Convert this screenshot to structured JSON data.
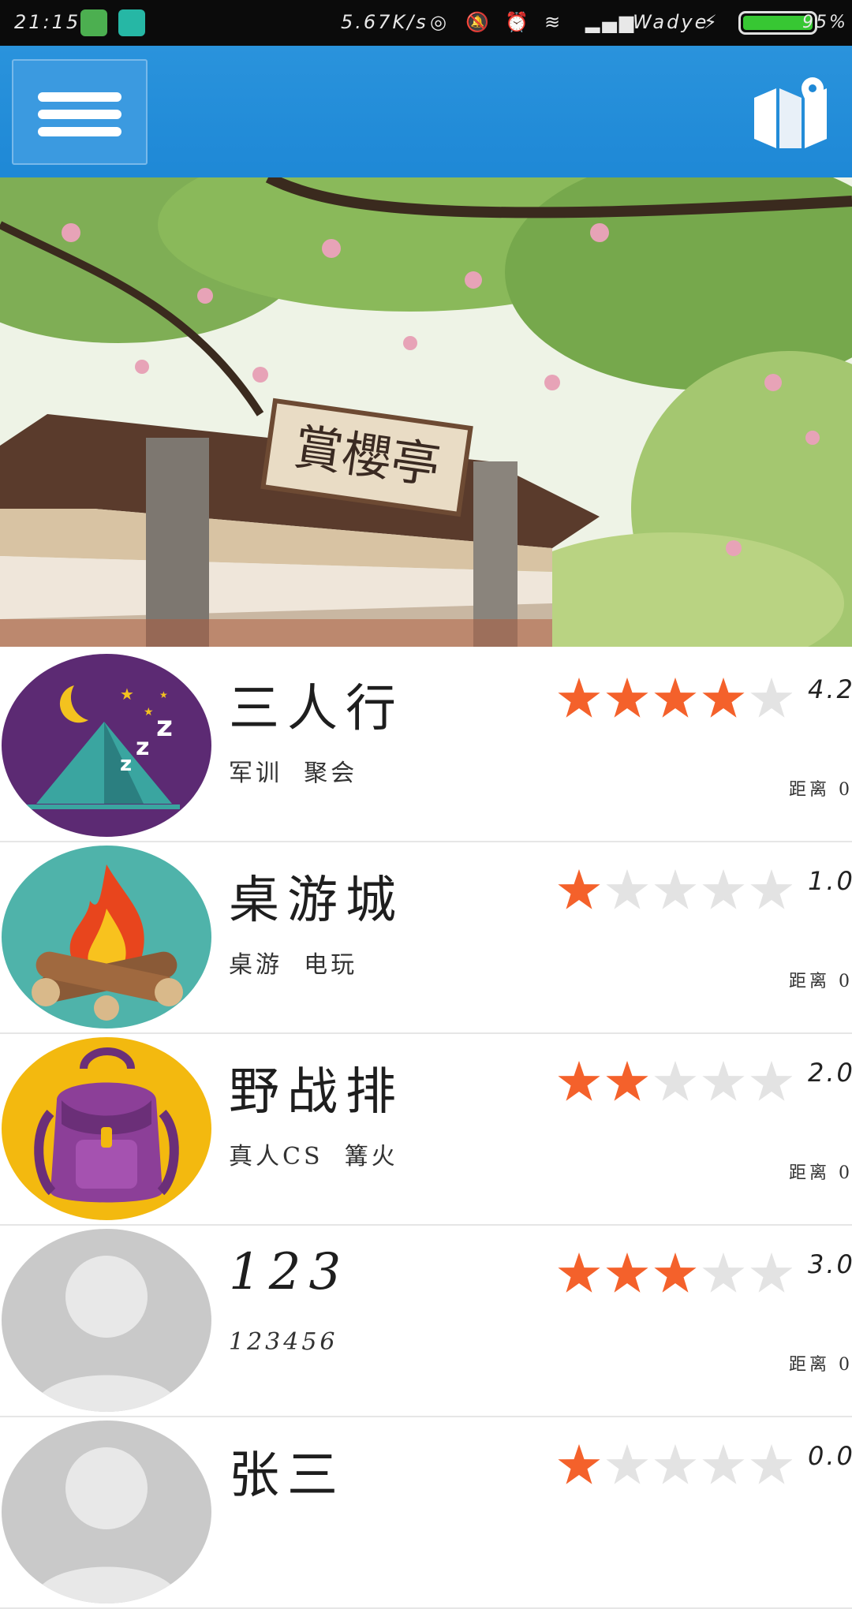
{
  "status_bar": {
    "time": "21:15",
    "net_speed": "5.67K/s",
    "carrier": "Wadye",
    "battery": "95%",
    "battery_level": 0.95
  },
  "header": {
    "menu_icon": "hamburger-menu-icon",
    "map_icon": "map-pin-icon"
  },
  "banner": {
    "sign_text": "賞櫻亭"
  },
  "list": {
    "items": [
      {
        "name": "三人行",
        "tags": "军训  聚会",
        "score": "4.2",
        "rating": 4.2,
        "distance_label": "距离 0",
        "avatar": "tent-night-icon",
        "avatar_bg": "#5c2a73"
      },
      {
        "name": "桌游城",
        "tags": "桌游  电玩",
        "score": "1.0",
        "rating": 1.0,
        "distance_label": "距离 0",
        "avatar": "campfire-icon",
        "avatar_bg": "#4fb3aa"
      },
      {
        "name": "野战排",
        "tags": "真人CS  篝火",
        "score": "2.0",
        "rating": 2.0,
        "distance_label": "距离 0",
        "avatar": "backpack-icon",
        "avatar_bg": "#f3b90f"
      },
      {
        "name": "123",
        "tags": "123456",
        "score": "3.0",
        "rating": 3.0,
        "distance_label": "距离 0",
        "avatar": "default-user-icon",
        "avatar_bg": "#c9c9c9"
      },
      {
        "name": "张三",
        "tags": "",
        "score": "0.0",
        "rating": 1.0,
        "distance_label": "",
        "avatar": "default-user-icon",
        "avatar_bg": "#c9c9c9"
      }
    ]
  },
  "colors": {
    "header_blue": "#1e88d6",
    "star_filled": "#f4612b",
    "star_empty": "#e3e3e3"
  }
}
